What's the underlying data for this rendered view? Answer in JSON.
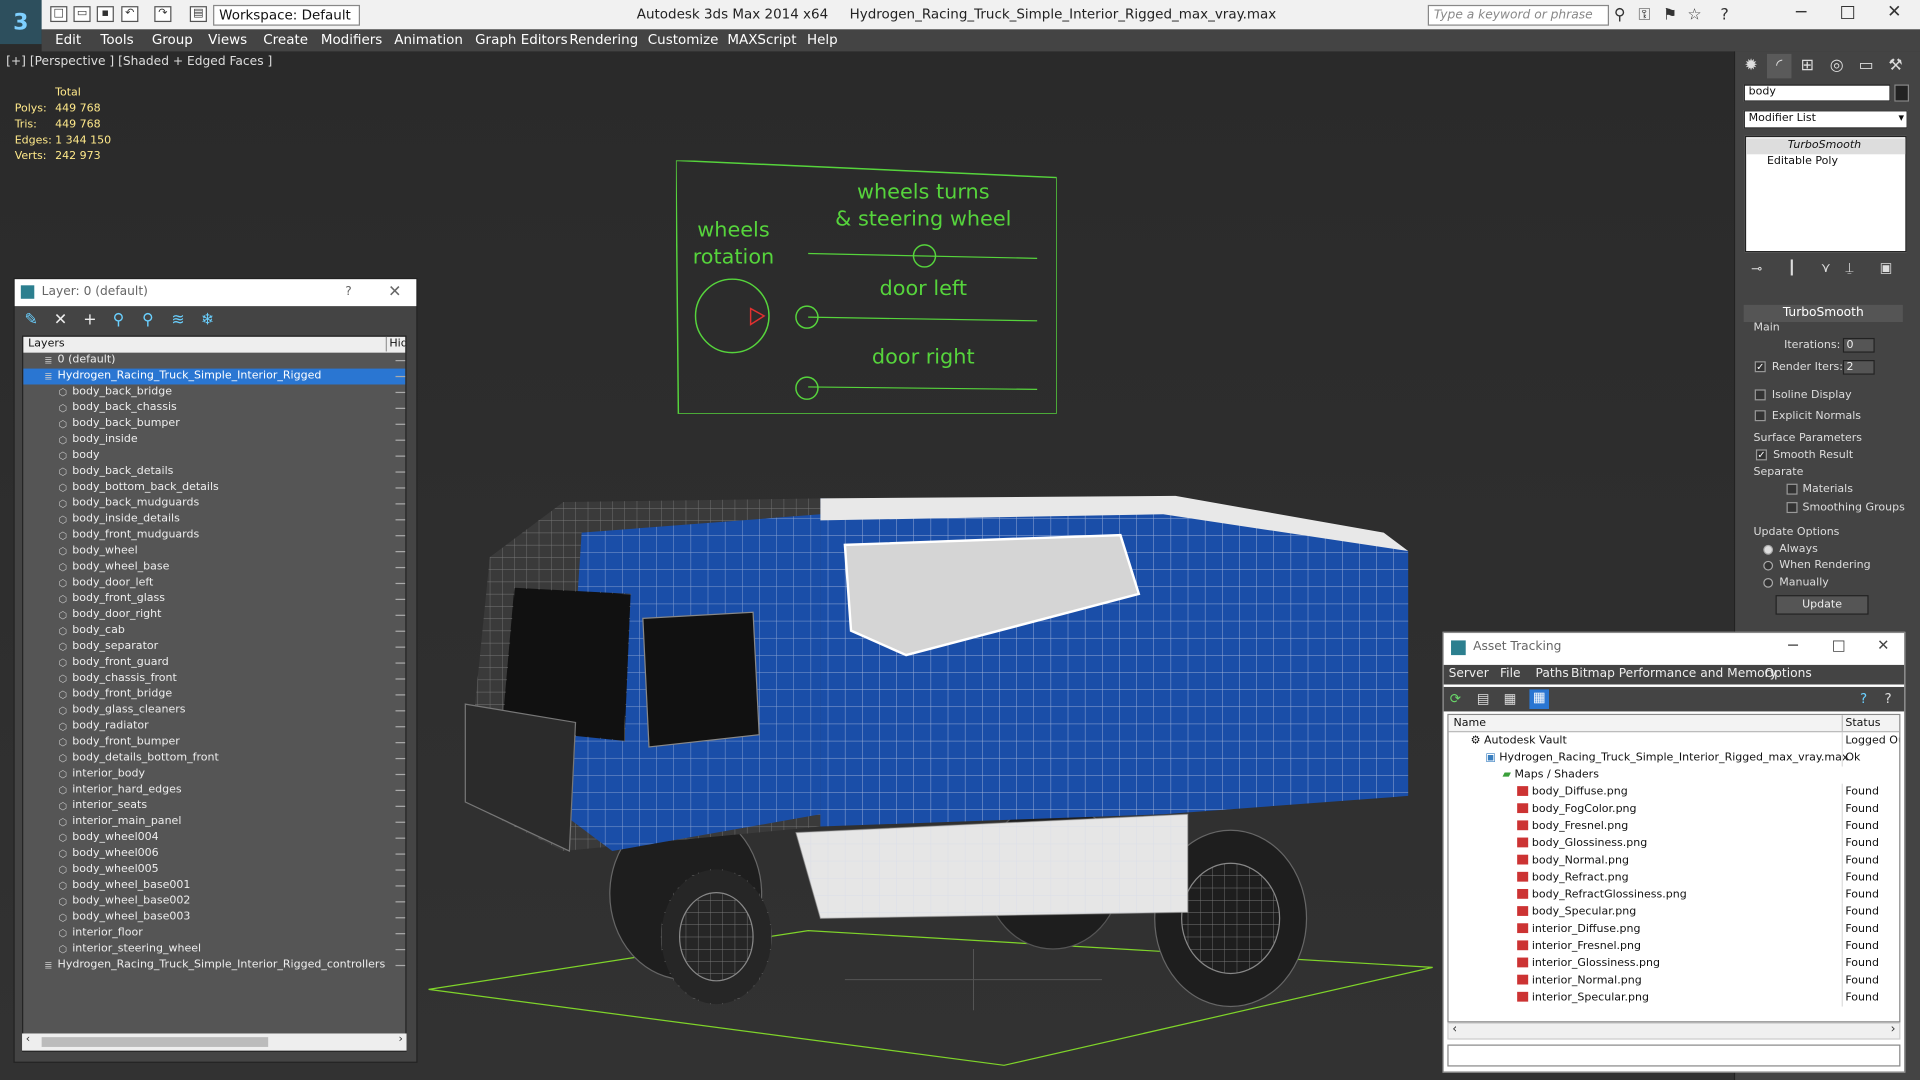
{
  "titlebar": {
    "title": "Autodesk 3ds Max  2014 x64",
    "filename": "Hydrogen_Racing_Truck_Simple_Interior_Rigged_max_vray.max",
    "workspace": "Workspace: Default",
    "search_placeholder": "Type a keyword or phrase"
  },
  "menu": [
    "Edit",
    "Tools",
    "Group",
    "Views",
    "Create",
    "Modifiers",
    "Animation",
    "Graph Editors",
    "Rendering",
    "Customize",
    "MAXScript",
    "Help"
  ],
  "viewport": {
    "label": "[+] [Perspective ] [Shaded + Edged Faces ]",
    "stats_header": "Total",
    "stats": [
      {
        "k": "Polys:",
        "v": "449 768"
      },
      {
        "k": "Tris:",
        "v": "449 768"
      },
      {
        "k": "Edges:",
        "v": "1 344 150"
      },
      {
        "k": "Verts:",
        "v": "242 973"
      }
    ]
  },
  "controls": {
    "wheels_turns_1": "wheels turns",
    "wheels_turns_2": "& steering wheel",
    "wheels_rotation_1": "wheels",
    "wheels_rotation_2": "rotation",
    "door_left": "door left",
    "door_right": "door right",
    "color": "#56d43c"
  },
  "command_panel": {
    "object_name": "body",
    "modifier_list": "Modifier List",
    "stack": [
      "TurboSmooth",
      "Editable Poly"
    ],
    "rollout": "TurboSmooth",
    "main": "Main",
    "iterations_label": "Iterations:",
    "iterations": "0",
    "render_iters_label": "Render Iters:",
    "render_iters": "2",
    "isoline": "Isoline Display",
    "explicit": "Explicit Normals",
    "surface": "Surface Parameters",
    "smooth_result": "Smooth Result",
    "separate": "Separate",
    "materials": "Materials",
    "smoothing_groups": "Smoothing Groups",
    "update_options": "Update Options",
    "always": "Always",
    "when_rendering": "When Rendering",
    "manually": "Manually",
    "update_btn": "Update"
  },
  "layers": {
    "title": "Layer: 0 (default)",
    "help": "?",
    "col_layers": "Layers",
    "col_hid": "Hid",
    "rows": [
      "0 (default)",
      "Hydrogen_Racing_Truck_Simple_Interior_Rigged",
      "body_back_bridge",
      "body_back_chassis",
      "body_back_bumper",
      "body_inside",
      "body",
      "body_back_details",
      "body_bottom_back_details",
      "body_back_mudguards",
      "body_inside_details",
      "body_front_mudguards",
      "body_wheel",
      "body_wheel_base",
      "body_door_left",
      "body_front_glass",
      "body_door_right",
      "body_cab",
      "body_separator",
      "body_front_guard",
      "body_chassis_front",
      "body_front_bridge",
      "body_glass_cleaners",
      "body_radiator",
      "body_front_bumper",
      "body_details_bottom_front",
      "interior_body",
      "interior_hard_edges",
      "interior_seats",
      "interior_main_panel",
      "body_wheel004",
      "body_wheel006",
      "body_wheel005",
      "body_wheel_base001",
      "body_wheel_base002",
      "body_wheel_base003",
      "interior_floor",
      "interior_steering_wheel",
      "Hydrogen_Racing_Truck_Simple_Interior_Rigged_controllers"
    ]
  },
  "asset_tracking": {
    "title": "Asset Tracking",
    "menu": [
      "Server",
      "File",
      "Paths",
      "Bitmap Performance and Memory",
      "Options"
    ],
    "col_name": "Name",
    "col_status": "Status",
    "vault": "Autodesk Vault",
    "vault_status": "Logged Ou",
    "file": "Hydrogen_Racing_Truck_Simple_Interior_Rigged_max_vray.max",
    "file_status": "Ok",
    "maps": "Maps / Shaders",
    "maps_list": [
      "body_Diffuse.png",
      "body_FogColor.png",
      "body_Fresnel.png",
      "body_Glossiness.png",
      "body_Normal.png",
      "body_Refract.png",
      "body_RefractGlossiness.png",
      "body_Specular.png",
      "interior_Diffuse.png",
      "interior_Fresnel.png",
      "interior_Glossiness.png",
      "interior_Normal.png",
      "interior_Specular.png"
    ],
    "found": "Found"
  }
}
